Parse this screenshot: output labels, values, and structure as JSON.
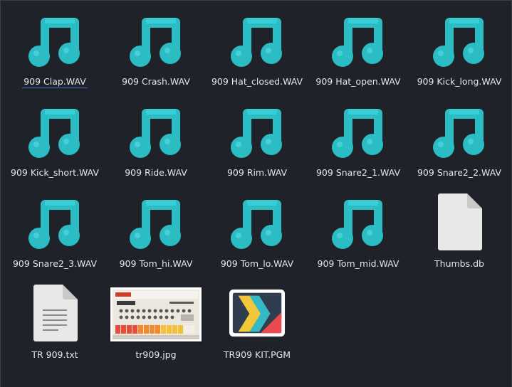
{
  "colors": {
    "background": "#1f2229",
    "music_icon": "#2fc4cb",
    "label_text": "#e6e6e6",
    "focus_underline": "#3d6cc0"
  },
  "files": [
    {
      "name": "909 Clap.WAV",
      "icon": "audio-icon"
    },
    {
      "name": "909 Crash.WAV",
      "icon": "audio-icon"
    },
    {
      "name": "909 Hat_closed.WAV",
      "icon": "audio-icon"
    },
    {
      "name": "909 Hat_open.WAV",
      "icon": "audio-icon"
    },
    {
      "name": "909 Kick_long.WAV",
      "icon": "audio-icon"
    },
    {
      "name": "909 Kick_short.WAV",
      "icon": "audio-icon"
    },
    {
      "name": "909 Ride.WAV",
      "icon": "audio-icon"
    },
    {
      "name": "909 Rim.WAV",
      "icon": "audio-icon"
    },
    {
      "name": "909 Snare2_1.WAV",
      "icon": "audio-icon"
    },
    {
      "name": "909 Snare2_2.WAV",
      "icon": "audio-icon"
    },
    {
      "name": "909 Snare2_3.WAV",
      "icon": "audio-icon"
    },
    {
      "name": "909 Tom_hi.WAV",
      "icon": "audio-icon"
    },
    {
      "name": "909 Tom_lo.WAV",
      "icon": "audio-icon"
    },
    {
      "name": "909 Tom_mid.WAV",
      "icon": "audio-icon"
    },
    {
      "name": "Thumbs.db",
      "icon": "generic-file-icon"
    },
    {
      "name": "TR 909.txt",
      "icon": "text-file-icon"
    },
    {
      "name": "tr909.jpg",
      "icon": "image-thumbnail"
    },
    {
      "name": "TR909 KIT.PGM",
      "icon": "program-icon"
    }
  ],
  "focused_index": 0
}
